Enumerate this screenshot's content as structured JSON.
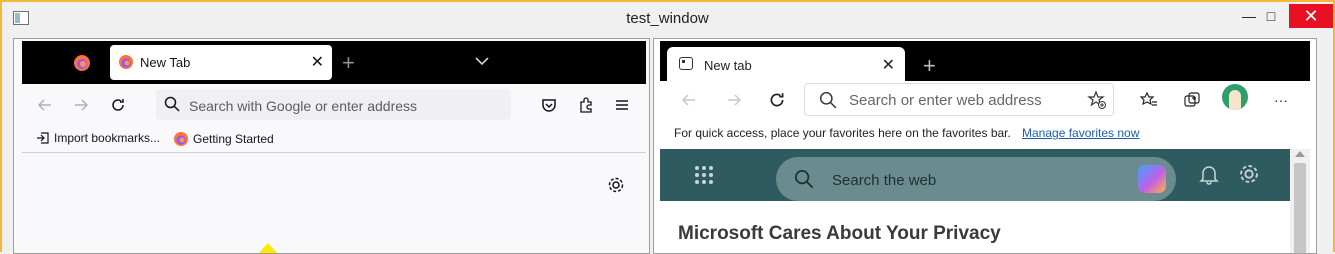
{
  "window": {
    "title": "test_window",
    "minimize": "—",
    "maximize": "□",
    "close": "✕"
  },
  "firefox": {
    "tab_label": "New Tab",
    "tab_close": "✕",
    "new_tab": "+",
    "url_placeholder": "Search with Google or enter address",
    "bookmarks": [
      "Import bookmarks...",
      "Getting Started"
    ]
  },
  "edge": {
    "tab_label": "New tab",
    "tab_close": "✕",
    "new_tab": "+",
    "url_placeholder": "Search or enter web address",
    "favbar_text": "For quick access, place your favorites here on the favorites bar.",
    "favbar_link": "Manage favorites now",
    "search_placeholder": "Search the web",
    "privacy_heading": "Microsoft Cares About Your Privacy",
    "more_label": "···"
  },
  "colors": {
    "window_border": "#f4b73a",
    "close_red": "#e81123",
    "hero_teal": "#2e5b5f"
  }
}
